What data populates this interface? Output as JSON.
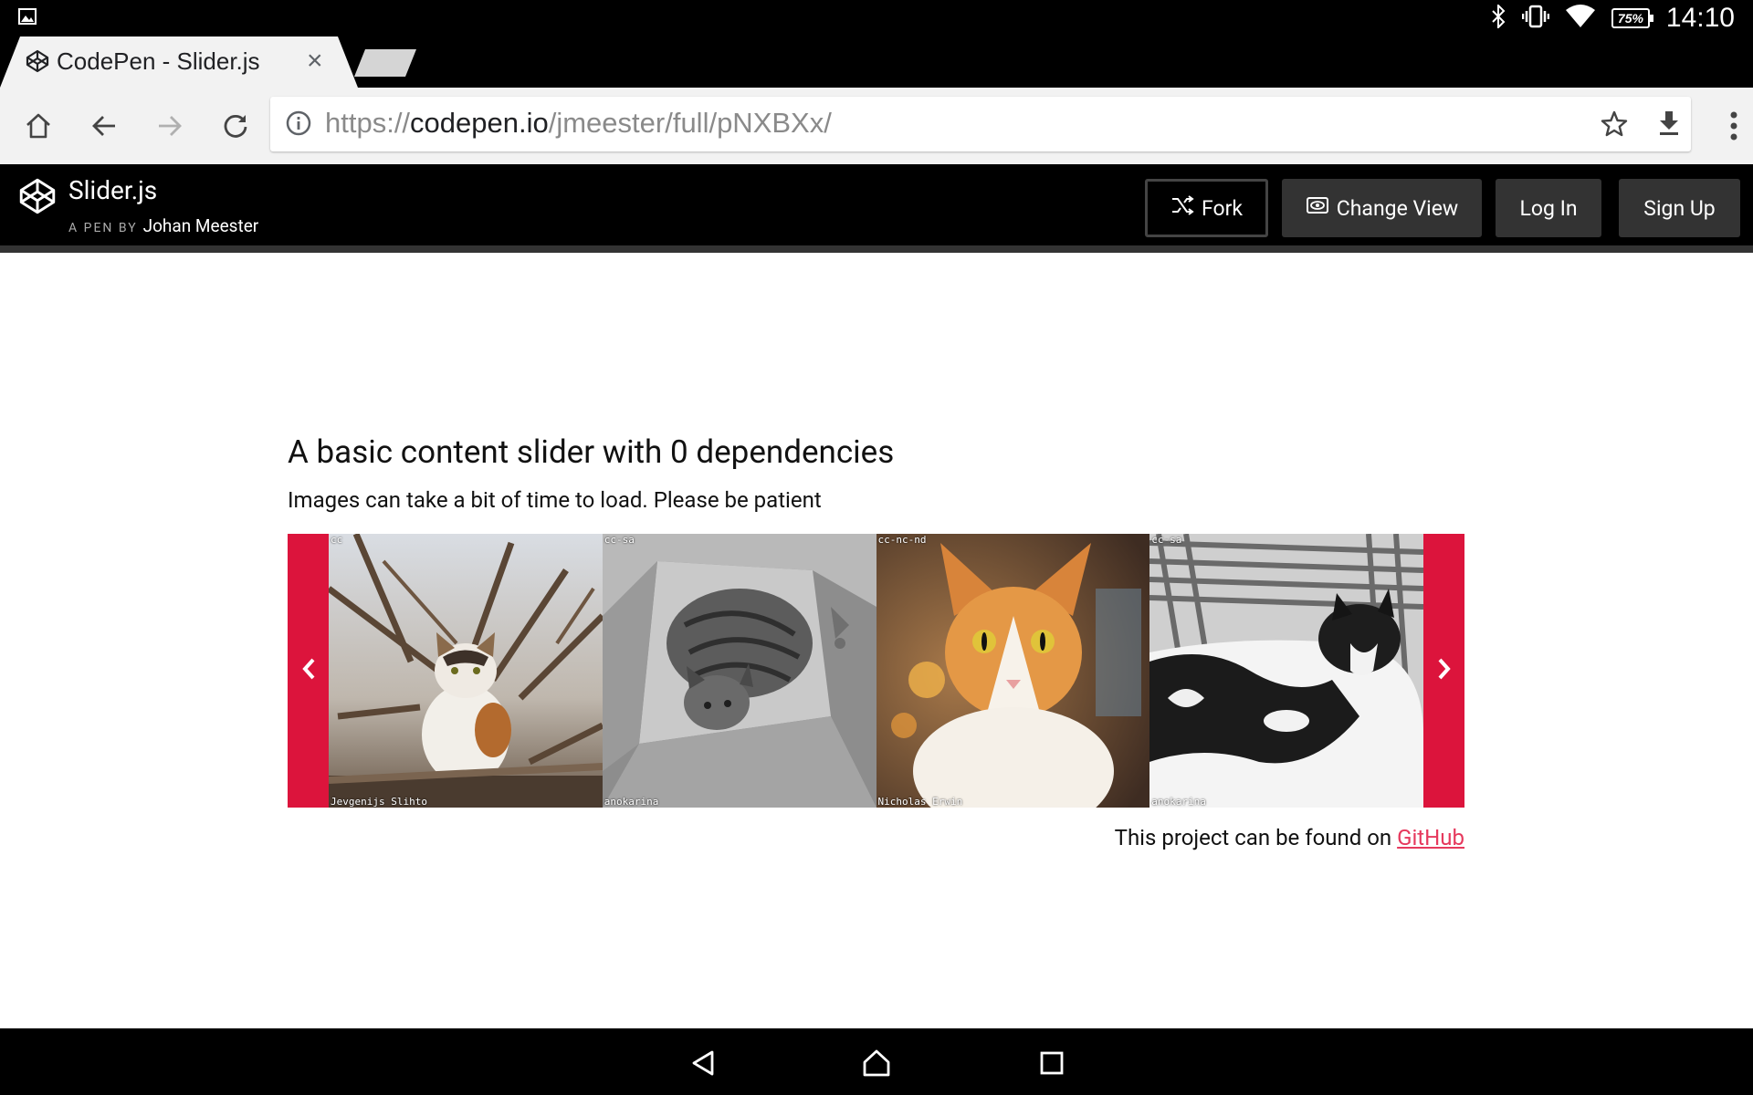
{
  "status_bar": {
    "battery": "75%",
    "time": "14:10"
  },
  "tab": {
    "title": "CodePen - Slider.js",
    "close": "×"
  },
  "toolbar": {
    "url_scheme": "https://",
    "url_host": "codepen.io",
    "url_path": "/jmeester/full/pNXBXx/"
  },
  "codepen": {
    "pen_title": "Slider.js",
    "byline_prefix": "A PEN BY",
    "author": "Johan Meester",
    "buttons": {
      "fork": "Fork",
      "change_view": "Change View",
      "log_in": "Log In",
      "sign_up": "Sign Up"
    }
  },
  "page": {
    "heading": "A basic content slider with 0 dependencies",
    "subtext": "Images can take a bit of time to load. Please be patient",
    "slides": [
      {
        "license": "cc",
        "author": "Jevgenijs Slihto"
      },
      {
        "license": "cc-sa",
        "author": "anokarina"
      },
      {
        "license": "cc-nc-nd",
        "author": "Nicholas Erwin"
      },
      {
        "license": "cc-sa",
        "author": "anokarina"
      }
    ],
    "footer_text": "This project can be found on ",
    "footer_link": "GitHub"
  },
  "colors": {
    "slider_accent": "#dc143c",
    "link": "#e6395d"
  },
  "icons": [
    "image-notification-icon",
    "bluetooth-icon",
    "vibrate-icon",
    "wifi-icon",
    "battery-icon",
    "codepen-favicon",
    "home-icon",
    "back-icon",
    "forward-icon",
    "reload-icon",
    "info-icon",
    "star-icon",
    "download-icon",
    "menu-icon",
    "codepen-logo",
    "fork-icon",
    "eye-icon",
    "chevron-left-icon",
    "chevron-right-icon",
    "nav-back-icon",
    "nav-home-icon",
    "nav-recents-icon"
  ]
}
